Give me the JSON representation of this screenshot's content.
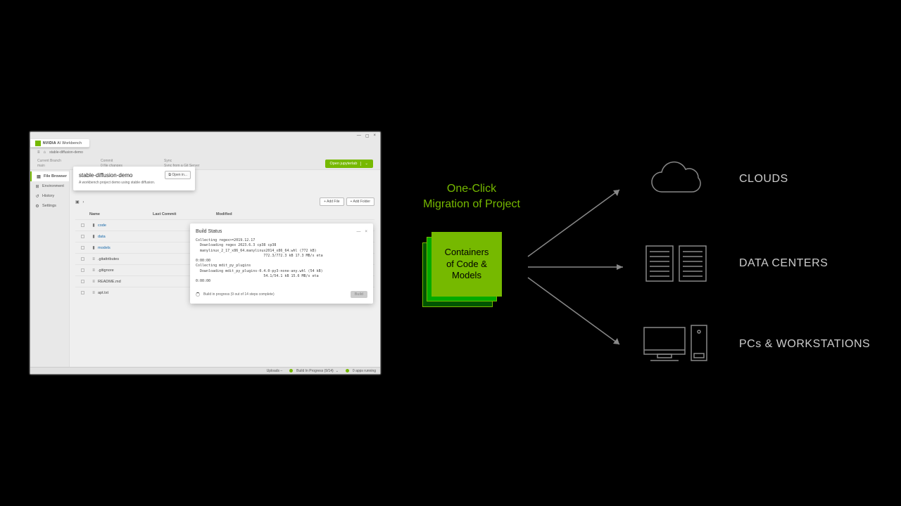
{
  "brand": {
    "logo": "NVIDIA",
    "suffix": "AI Workbench"
  },
  "window": {
    "min": "—",
    "max": "▢",
    "close": "×"
  },
  "breadcrumb": {
    "home_icon": "⌂",
    "project": "stable-diffusion-demo"
  },
  "row2": {
    "branch": {
      "label": "Current Branch",
      "value": "main"
    },
    "commit": {
      "label": "Commit",
      "value": "0 file changes"
    },
    "sync": {
      "label": "Sync",
      "value": "Sync from a Git Server"
    },
    "open_button": "Open jupyterlab",
    "chevron": "⌄"
  },
  "sidebar": {
    "items": [
      {
        "icon": "▤",
        "label": "File Browser"
      },
      {
        "icon": "⊞",
        "label": "Environment"
      },
      {
        "icon": "↺",
        "label": "History"
      },
      {
        "icon": "⚙",
        "label": "Settings"
      }
    ]
  },
  "card": {
    "title": "stable-diffusion-demo",
    "desc": "A workbench project demo using stable diffusion.",
    "open": "⧉ Open in..."
  },
  "toolbar": {
    "crumb_root": "▣",
    "crumb_sep": "›",
    "add_file": "+ Add File",
    "add_folder": "+ Add Folder"
  },
  "table": {
    "headers": {
      "name": "Name",
      "last_commit": "Last Commit",
      "modified": "Modified"
    },
    "rows": [
      {
        "type": "folder",
        "icon": "▮",
        "name": "code"
      },
      {
        "type": "folder",
        "icon": "▮",
        "name": "data"
      },
      {
        "type": "folder",
        "icon": "▮",
        "name": "models"
      },
      {
        "type": "file",
        "icon": "≡",
        "name": ".gitattributes"
      },
      {
        "type": "file",
        "icon": "≡",
        "name": ".gitignore"
      },
      {
        "type": "file",
        "icon": "≡",
        "name": "README.md"
      },
      {
        "type": "file",
        "icon": "≡",
        "name": "apt.txt"
      }
    ]
  },
  "build": {
    "title": "Build Status",
    "collapse": "—",
    "close": "×",
    "log": "Collecting regex>=2019.12.17\n  Downloading regex 2023.6.3 cp38 cp38\n  manylinux_2_17_x86_64.manylinux2014_x86_64.whl (772 kB)\n                                772.3/772.3 kB 17.3 MB/s eta\n0:00:00\nCollecting mdit_py_plugins\n  Downloading mdit_py_plugins-0.4.0-py3-none-any.whl (54 kB)\n                                54.1/54.1 kB 15.6 MB/s eta\n0:00:00",
    "progress": "Build in progress (9 out of 14 steps complete)",
    "button": "Build"
  },
  "statusbar": {
    "uploads": "Uploads  –",
    "build": "Build In Progress (9/14)",
    "apps": "0 apps running"
  },
  "diagram": {
    "headline": "One-Click\nMigration of Project",
    "container": "Containers\nof Code &\nModels",
    "targets": [
      "CLOUDS",
      "DATA CENTERS",
      "PCs & WORKSTATIONS"
    ]
  }
}
